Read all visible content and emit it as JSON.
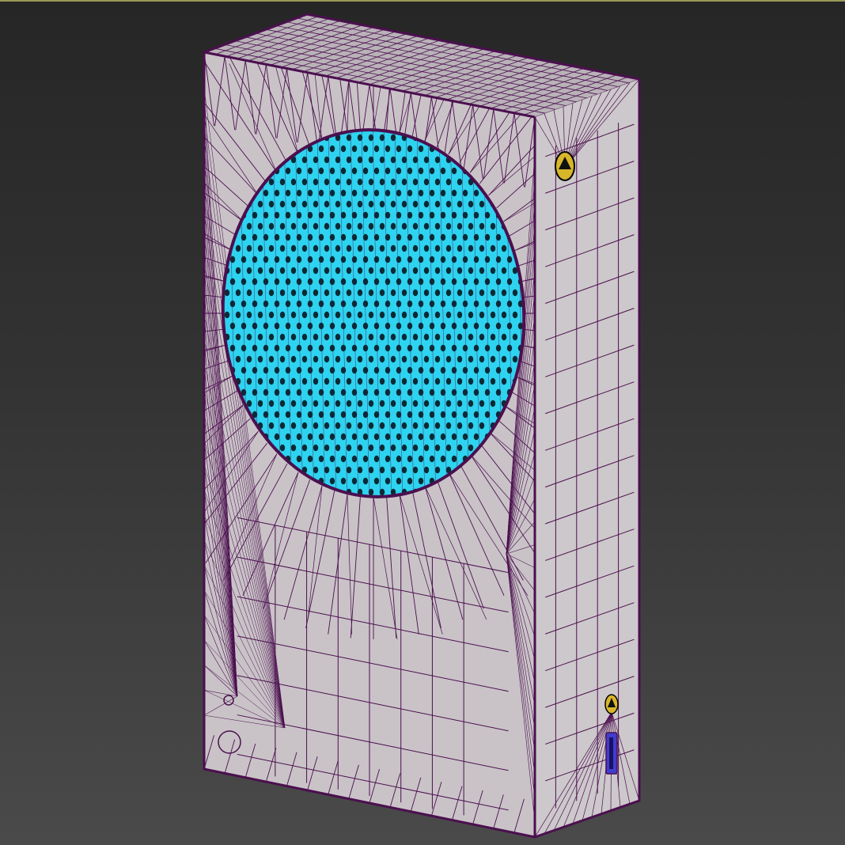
{
  "viewport": {
    "background_top": "#262626",
    "background_bottom": "#4a4a4a",
    "top_edge_color": "#9a9a55"
  },
  "model": {
    "wire_color": "#4b0f4f",
    "face_color": "#c9c3c7",
    "side_face_color": "#cdc8cb",
    "top_face_color": "#b9b3b8",
    "vent_color": "#2ed3f0",
    "vent_hole_color": "#0a2a35",
    "button_color": "#d7b62a",
    "port_color": "#3f3cd0",
    "icons": [
      "power-button-icon",
      "controller-pair-button-icon",
      "usb-port-icon"
    ]
  }
}
